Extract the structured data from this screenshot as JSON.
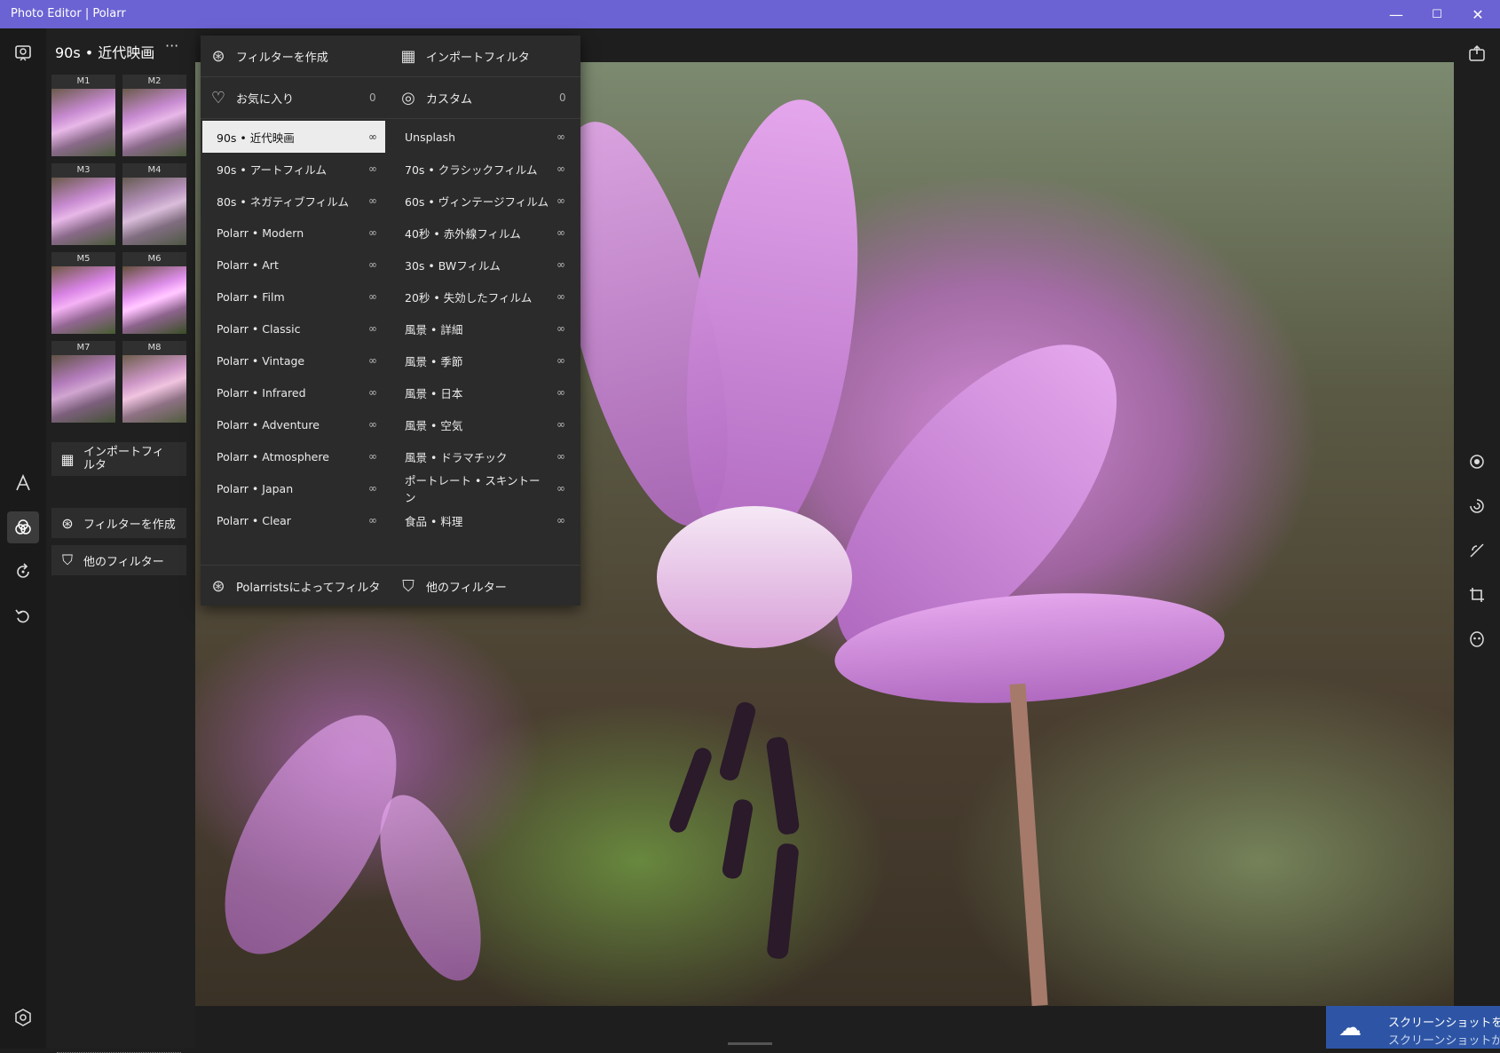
{
  "window": {
    "title": "Photo Editor | Polarr",
    "min": "—",
    "max": "☐",
    "close": "✕"
  },
  "panel": {
    "title": "90s • 近代映画",
    "more": "···",
    "thumbs": [
      "M1",
      "M2",
      "M3",
      "M4",
      "M5",
      "M6",
      "M7",
      "M8"
    ],
    "buttons": [
      {
        "label": "インポートフィルタ",
        "icon": "qr-icon"
      },
      {
        "label": "フィルターを作成",
        "icon": "create-filter-icon"
      },
      {
        "label": "他のフィルター",
        "icon": "shopping-bag-icon"
      }
    ]
  },
  "dropdown": {
    "create": "フィルターを作成",
    "import": "インポートフィルタ",
    "favorites": "お気に入り",
    "favorites_count": "0",
    "custom": "カスタム",
    "custom_count": "0",
    "left": [
      "90s • 近代映画",
      "90s • アートフィルム",
      "80s • ネガティブフィルム",
      "Polarr • Modern",
      "Polarr • Art",
      "Polarr • Film",
      "Polarr • Classic",
      "Polarr • Vintage",
      "Polarr • Infrared",
      "Polarr • Adventure",
      "Polarr • Atmosphere",
      "Polarr • Japan",
      "Polarr • Clear"
    ],
    "right": [
      "Unsplash",
      "70s • クラシックフィルム",
      "60s • ヴィンテージフィルム",
      "40秒 • 赤外線フィルム",
      "30s • BWフィルム",
      "20秒 • 失効したフィルム",
      "風景 • 詳細",
      "風景 • 季節",
      "風景 • 日本",
      "風景 • 空気",
      "風景 • ドラマチック",
      "ポートレート • スキントーン",
      "食品 • 料理"
    ],
    "infinity": "∞",
    "by_polarrists": "Polarristsによってフィルタ",
    "more_filters": "他のフィルター"
  },
  "toast": {
    "line1": "スクリーンショットを保存しました",
    "line2": "スクリーンショットが OneDrive に"
  }
}
